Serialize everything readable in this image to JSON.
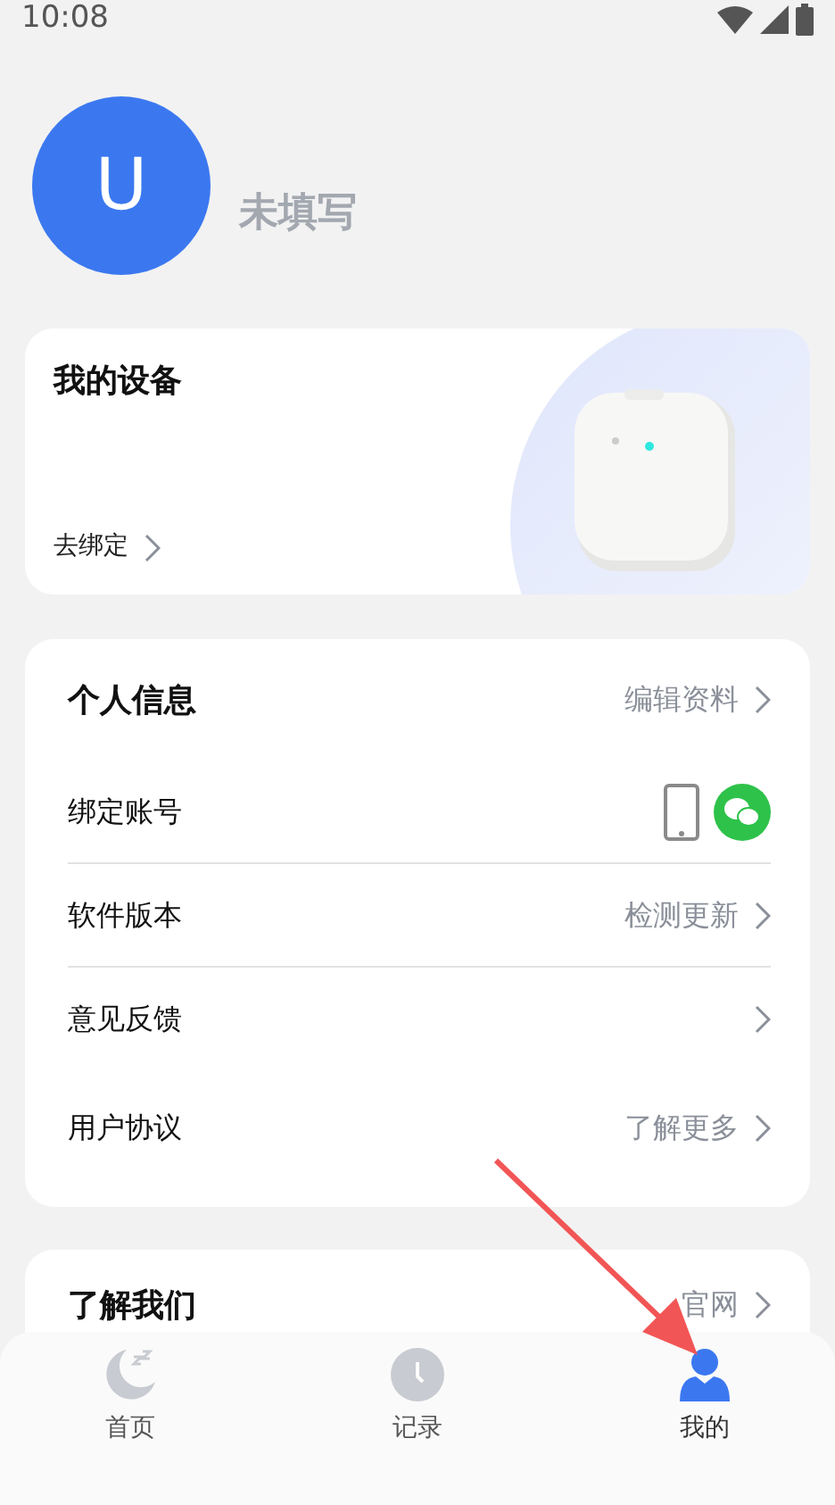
{
  "status_bar": {
    "time": "10:08"
  },
  "profile": {
    "avatar_letter": "U",
    "name": "未填写"
  },
  "device_card": {
    "title": "我的设备",
    "action": "去绑定",
    "kind": "picture"
  },
  "info_card": {
    "title": "个人信息",
    "action": "编辑资料",
    "rows": [
      {
        "label": "绑定账号",
        "kind": "accounts",
        "divider": true
      },
      {
        "label": "软件版本",
        "kind": "link",
        "value": "检测更新",
        "divider": true
      },
      {
        "label": "意见反馈",
        "kind": "link",
        "divider": false
      },
      {
        "label": "用户协议",
        "kind": "link",
        "value": "了解更多",
        "divider": false
      }
    ]
  },
  "about_card": {
    "title": "了解我们",
    "action": "官网"
  },
  "tabs": [
    {
      "label": "首页",
      "kind": "moon",
      "selected": false
    },
    {
      "label": "记录",
      "kind": "clock",
      "selected": false
    },
    {
      "label": "我的",
      "kind": "person",
      "selected": true
    }
  ]
}
